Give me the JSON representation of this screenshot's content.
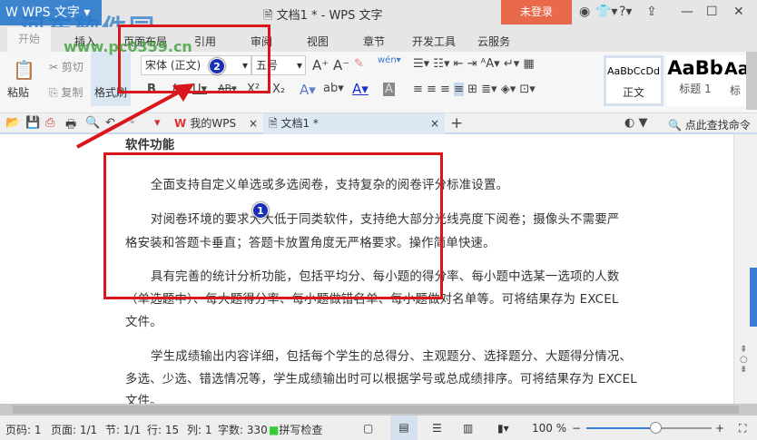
{
  "titlebar": {
    "app": "WPS 文字",
    "title": "文档1 * - WPS 文字",
    "login": "未登录"
  },
  "watermark": {
    "name": "河东软件园",
    "url": "www.pc0359.cn"
  },
  "menu": [
    "开始",
    "插入",
    "页面布局",
    "引用",
    "审阅",
    "视图",
    "章节",
    "开发工具",
    "云服务"
  ],
  "ribbon": {
    "paste": "粘贴",
    "cut": "剪切",
    "copy": "复制",
    "format_painter": "格式刷",
    "font": "宋体 (正文)",
    "size": "五号",
    "styles": [
      {
        "sample": "AaBbCcDd",
        "name": "正文"
      },
      {
        "sample": "AaBb",
        "name": "标题 1"
      },
      {
        "sample": "Aa",
        "name": "标"
      }
    ]
  },
  "tabs": {
    "mywps": "我的WPS",
    "doc": "文档1 *",
    "search": "点此查找命令"
  },
  "document": {
    "heading": "软件功能",
    "paragraphs": [
      [
        "全面支持自定义单选或多选阅卷，支持复杂的阅卷评分标准设置。"
      ],
      [
        "对阅卷环境的要求大大低于同类软件，支持绝大部分光线亮度下阅卷；摄像头不需要严",
        "格安装和答题卡垂直；答题卡放置角度无严格要求。操作简单快速。"
      ],
      [
        "具有完善的统计分析功能，包括平均分、每小题的得分率、每小题中选某一选项的人数",
        "（单选题中）、每大题得分率、每小题做错名单、每小题做对名单等。可将结果存为 EXCEL",
        "文件。"
      ],
      [
        "学生成绩输出内容详细，包括每个学生的总得分、主观题分、选择题分、大题得分情况、",
        "多选、少选、错选情况等，学生成绩输出时可以根据学号或总成绩排序。可将结果存为 EXCEL",
        "文件。"
      ]
    ]
  },
  "status": {
    "page": "页码: 1",
    "pages": "页面: 1/1",
    "section": "节: 1/1",
    "row": "行: 15",
    "col": "列: 1",
    "words": "字数: 330",
    "spell": "拼写检查",
    "zoom": "100 %",
    "zoom_fraction": 0.55
  },
  "annotations": {
    "one": "1",
    "two": "2"
  }
}
